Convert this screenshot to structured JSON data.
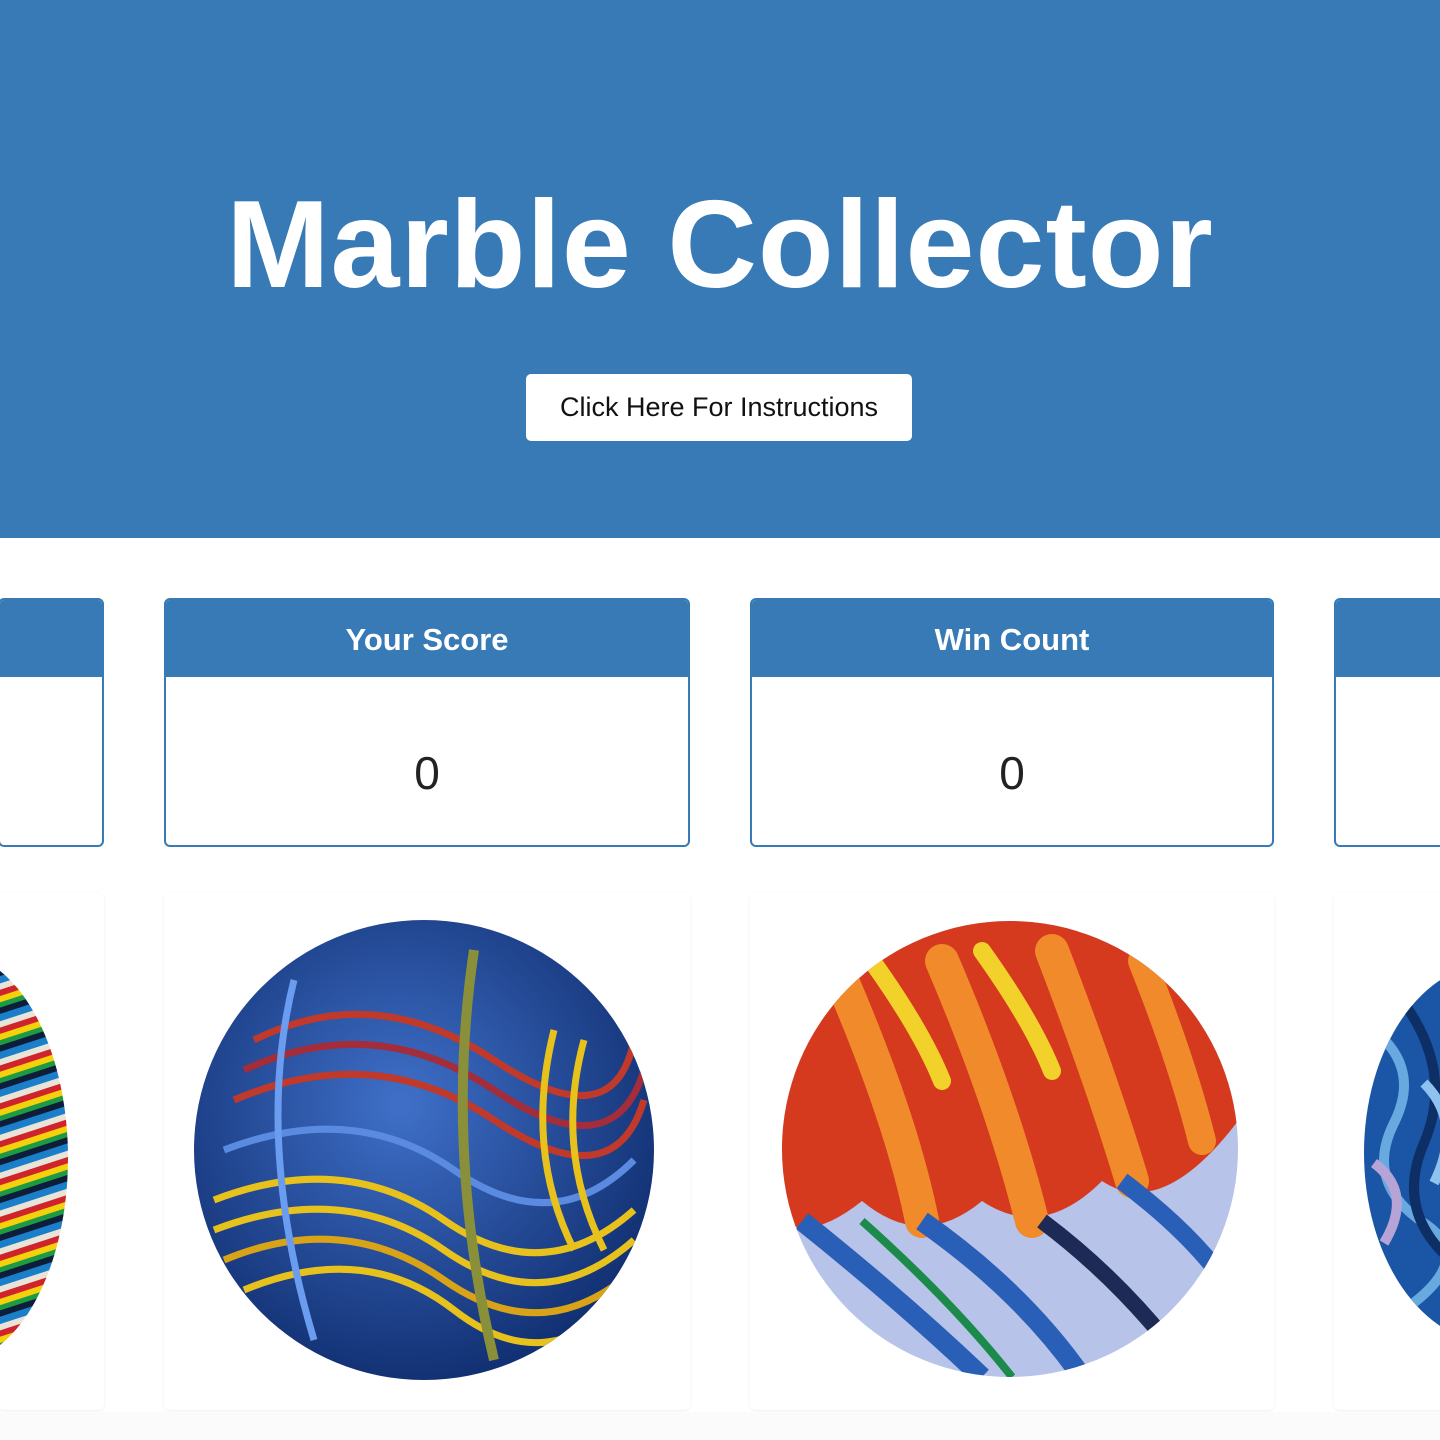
{
  "header": {
    "title": "Marble Collector",
    "instructions_button": "Click Here For Instructions"
  },
  "stats": [
    {
      "label": "",
      "value": ""
    },
    {
      "label": "Your Score",
      "value": "0"
    },
    {
      "label": "Win Count",
      "value": "0"
    },
    {
      "label": "",
      "value": ""
    }
  ],
  "marbles": [
    {
      "icon": "striped-marble-icon",
      "colors": [
        "#1b7ec9",
        "#e9e4d8",
        "#d0242c",
        "#f5d10c",
        "#1c9a44"
      ]
    },
    {
      "icon": "blue-swirl-marble-icon",
      "colors": [
        "#163c8c",
        "#3f70c9",
        "#c0392b",
        "#e8c21c"
      ]
    },
    {
      "icon": "flame-marble-icon",
      "colors": [
        "#d63a1e",
        "#f08a2a",
        "#f3d12b",
        "#2a5fb8",
        "#b8c3ea"
      ]
    },
    {
      "icon": "blue-marble-icon",
      "colors": [
        "#1a56a5",
        "#68a9e0",
        "#b7a4d6"
      ]
    }
  ],
  "theme": {
    "primary": "#377ab5",
    "background": "#ffffff"
  }
}
